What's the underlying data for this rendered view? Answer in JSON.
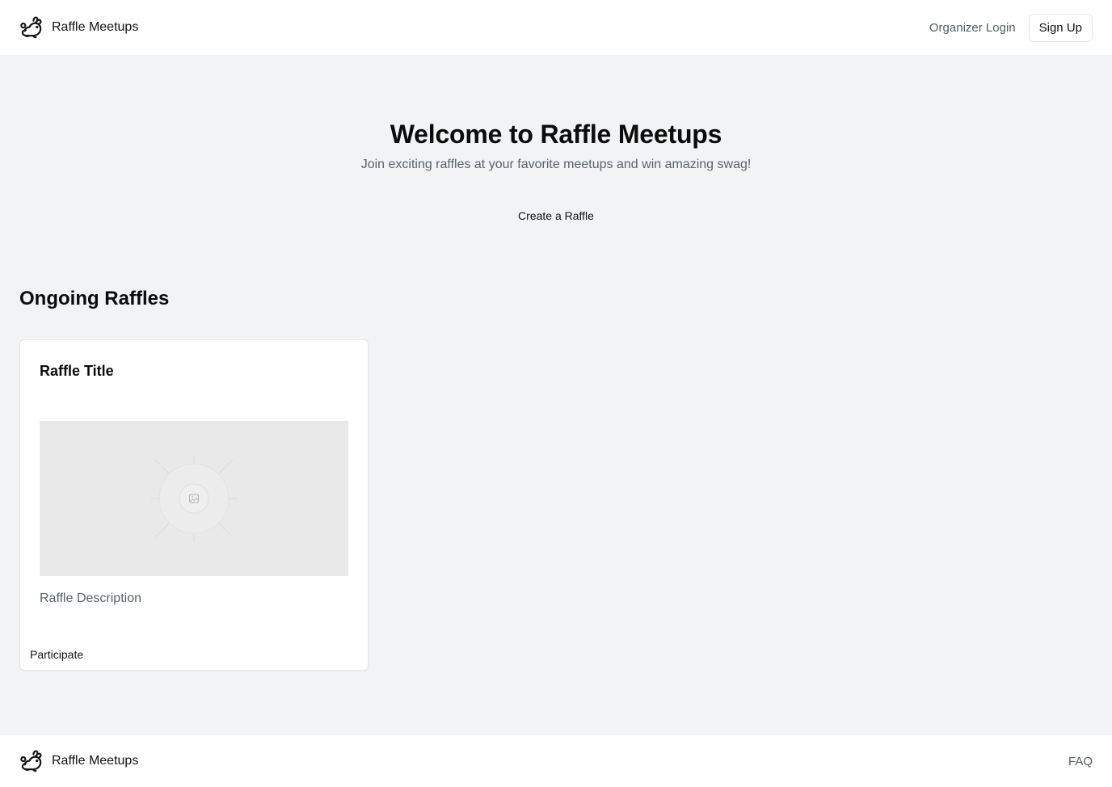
{
  "header": {
    "brand_name": "Raffle Meetups",
    "organizer_login": "Organizer Login",
    "sign_up": "Sign Up"
  },
  "hero": {
    "title": "Welcome to Raffle Meetups",
    "subtitle": "Join exciting raffles at your favorite meetups and win amazing swag!",
    "cta": "Create a Raffle"
  },
  "ongoing": {
    "heading": "Ongoing Raffles",
    "raffles": [
      {
        "title": "Raffle Title",
        "image_icon": "image-placeholder-icon",
        "description": "Raffle Description",
        "action": "Participate"
      }
    ]
  },
  "footer": {
    "brand_name": "Raffle Meetups",
    "faq": "FAQ"
  },
  "colors": {
    "page_bg": "#f2f3f4",
    "surface": "#ffffff",
    "text_primary": "#0b0b0b",
    "text_muted": "#5a6270",
    "placeholder_bg": "#e9e9e9"
  }
}
